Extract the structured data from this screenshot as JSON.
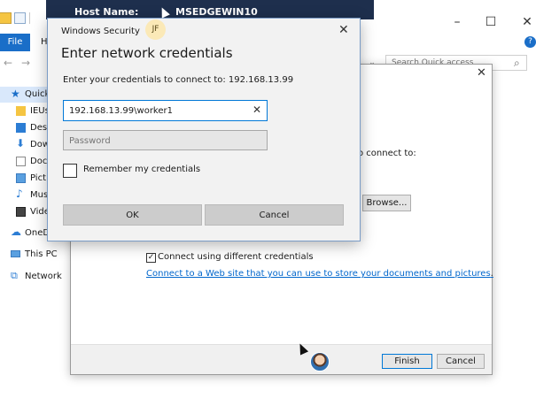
{
  "explorer": {
    "title_left": "Host Name:",
    "title_right": "MSEDGEWIN10",
    "file_tab": "File",
    "home_tab": "H",
    "search_placeholder": "Search Quick access",
    "nav_items": [
      "Quick",
      "IEUs",
      "Desk",
      "Dow",
      "Doc",
      "Pict",
      "Mus",
      "Vide",
      "OneD",
      "This PC",
      "Network"
    ]
  },
  "wizard": {
    "connect_to_text": "o connect to:",
    "browse_label": "Browse...",
    "different_credentials_label": "Connect using different credentials",
    "different_credentials_checked": true,
    "web_link": "Connect to a Web site that you can use to store your documents and pictures",
    "web_link_period": ".",
    "finish_label": "Finish",
    "cancel_label": "Cancel"
  },
  "security": {
    "window_title": "Windows Security",
    "avatar_initials": "JF",
    "heading": "Enter network credentials",
    "description": "Enter your credentials to connect to: 192.168.13.99",
    "username_value": "192.168.13.99\\worker1",
    "password_placeholder": "Password",
    "remember_label": "Remember my credentials",
    "remember_checked": false,
    "ok_label": "OK",
    "cancel_label": "Cancel"
  },
  "icons": {
    "close": "close-icon",
    "search": "search-icon",
    "clear": "clear-text-icon",
    "check": "checkmark-icon"
  },
  "colors": {
    "accent": "#0078d7",
    "file_tab": "#1a6ec8",
    "link": "#0066cc",
    "title_bar_dark": "#1e2f4d"
  }
}
